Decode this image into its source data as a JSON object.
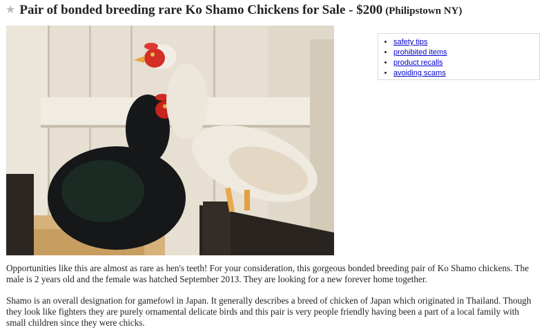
{
  "posting": {
    "title": "Pair of bonded breeding rare Ko Shamo Chickens for Sale - $200",
    "location": "(Philipstown NY)",
    "star_icon": "star-icon"
  },
  "image": {
    "subject": "photo",
    "colors": {
      "wood_light": "#e9e3d6",
      "wood_dark": "#2a2522",
      "hen_black": "#141618",
      "hen_sheen": "#1f3a2c",
      "rooster_white": "#f1ede4",
      "comb_red": "#d22a25",
      "straw": "#d9b47a"
    }
  },
  "safety_links": [
    {
      "label": "safety tips"
    },
    {
      "label": "prohibited items"
    },
    {
      "label": "product recalls"
    },
    {
      "label": "avoiding scams"
    }
  ],
  "description": {
    "paragraph_1": "Opportunities like this are almost as rare as hen's teeth! For your consideration, this gorgeous bonded breeding pair of Ko Shamo chickens. The male is 2 years old and the female was hatched September 2013. They are looking for a new forever home together.",
    "paragraph_2": "Shamo is an overall designation for gamefowl in Japan. It generally describes a breed of chicken of Japan which originated in Thailand. Though they look like fighters they are purely ornamental delicate birds and this pair is very people friendly having been a part of a local family with small children since they were chicks."
  }
}
